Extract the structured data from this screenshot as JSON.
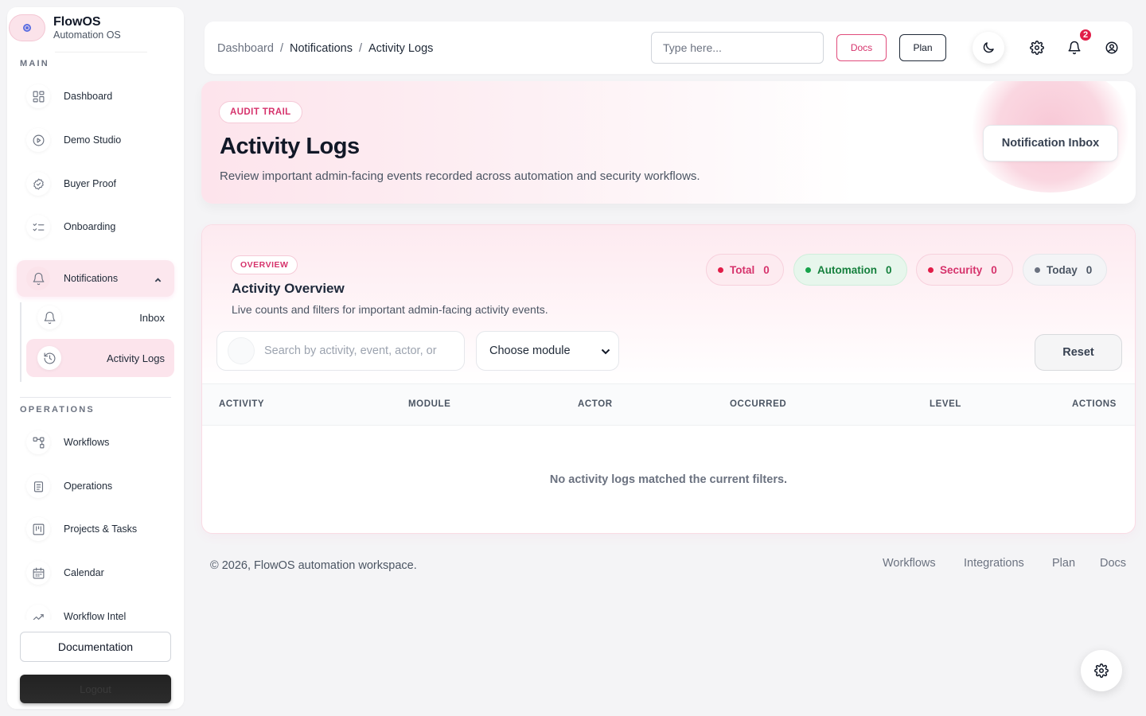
{
  "brand": {
    "name": "FlowOS",
    "subtitle": "Automation OS"
  },
  "sidebar": {
    "sections": {
      "main": "MAIN",
      "operations": "OPERATIONS"
    },
    "main_items": [
      {
        "label": "Dashboard",
        "icon": "grid-icon"
      },
      {
        "label": "Demo Studio",
        "icon": "play-icon"
      },
      {
        "label": "Buyer Proof",
        "icon": "badge-check-icon"
      },
      {
        "label": "Onboarding",
        "icon": "checklist-icon"
      },
      {
        "label": "Notifications",
        "icon": "bell-icon",
        "expanded": true
      }
    ],
    "sub_items": [
      {
        "label": "Inbox",
        "icon": "bell-icon"
      },
      {
        "label": "Activity Logs",
        "icon": "history-icon",
        "active": true
      }
    ],
    "ops_items": [
      {
        "label": "Workflows",
        "icon": "workflow-icon"
      },
      {
        "label": "Operations",
        "icon": "clipboard-icon"
      },
      {
        "label": "Projects & Tasks",
        "icon": "kanban-icon"
      },
      {
        "label": "Calendar",
        "icon": "calendar-icon"
      },
      {
        "label": "Workflow Intel",
        "icon": "chart-icon"
      }
    ],
    "documentation_label": "Documentation",
    "logout_label": "Logout"
  },
  "header": {
    "breadcrumbs": [
      "Dashboard",
      "Notifications",
      "Activity Logs"
    ],
    "search_placeholder": "Type here...",
    "docs_label": "Docs",
    "plan_label": "Plan",
    "notification_count": "2"
  },
  "hero": {
    "tag": "AUDIT TRAIL",
    "title": "Activity Logs",
    "subtitle": "Review important admin-facing events recorded across automation and security workflows.",
    "inbox_button": "Notification Inbox"
  },
  "overview": {
    "tag": "OVERVIEW",
    "title": "Activity Overview",
    "subtitle": "Live counts and filters for important admin-facing activity events.",
    "stats": [
      {
        "label": "Total",
        "value": "0"
      },
      {
        "label": "Automation",
        "value": "0"
      },
      {
        "label": "Security",
        "value": "0"
      },
      {
        "label": "Today",
        "value": "0"
      }
    ],
    "search_placeholder": "Search by activity, event, actor, or",
    "module_select": "Choose module",
    "reset_label": "Reset",
    "columns": [
      "ACTIVITY",
      "MODULE",
      "ACTOR",
      "OCCURRED",
      "LEVEL",
      "ACTIONS"
    ],
    "empty_message": "No activity logs matched the current filters."
  },
  "footer": {
    "copyright": "© 2026, FlowOS automation workspace.",
    "links": [
      "Workflows",
      "Integrations",
      "Plan",
      "Docs"
    ]
  },
  "colors": {
    "accent": "#d6336c",
    "success": "#15803d",
    "badge": "#e11d48"
  }
}
